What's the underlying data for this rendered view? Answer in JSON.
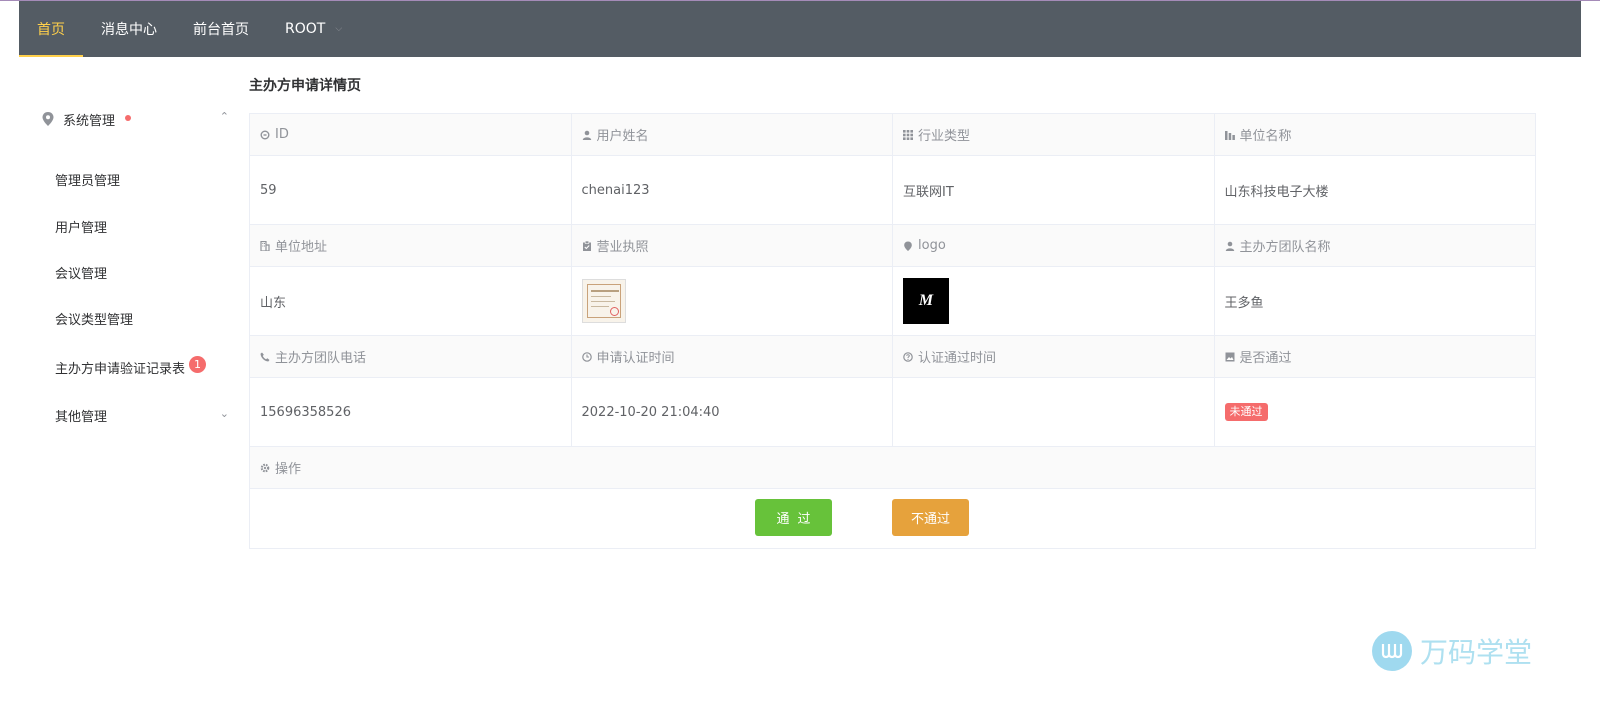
{
  "nav": {
    "items": [
      {
        "label": "首页"
      },
      {
        "label": "消息中心"
      },
      {
        "label": "前台首页"
      },
      {
        "label": "ROOT"
      }
    ]
  },
  "sidebar": {
    "group_title": "系统管理",
    "items": [
      {
        "label": "管理员管理"
      },
      {
        "label": "用户管理"
      },
      {
        "label": "会议管理"
      },
      {
        "label": "会议类型管理"
      },
      {
        "label": "主办方申请验证记录表",
        "badge": "1"
      },
      {
        "label": "其他管理"
      }
    ]
  },
  "page": {
    "title": "主办方申请详情页"
  },
  "details": {
    "labels": {
      "id": "ID",
      "username": "用户姓名",
      "industry": "行业类型",
      "company": "单位名称",
      "address": "单位地址",
      "license": "营业执照",
      "logo": "logo",
      "team_name": "主办方团队名称",
      "team_phone": "主办方团队电话",
      "apply_time": "申请认证时间",
      "pass_time": "认证通过时间",
      "passed": "是否通过",
      "actions": "操作"
    },
    "values": {
      "id": "59",
      "username": "chenai123",
      "industry": "互联网IT",
      "company": "山东科技电子大楼",
      "address": "山东",
      "team_name": "王多鱼",
      "team_phone": "15696358526",
      "apply_time": "2022-10-20 21:04:40",
      "pass_time": "",
      "passed": "未通过",
      "logo_letter": "M"
    }
  },
  "actions": {
    "pass_label": "通过",
    "reject_label": "不通过"
  },
  "watermark": {
    "text": "万码学堂"
  },
  "colors": {
    "navbar": "#545c64",
    "nav_active": "#ffd04b",
    "pass_button": "#67c23a",
    "reject_button": "#e6a23c",
    "fail_tag": "#f56c6c"
  }
}
